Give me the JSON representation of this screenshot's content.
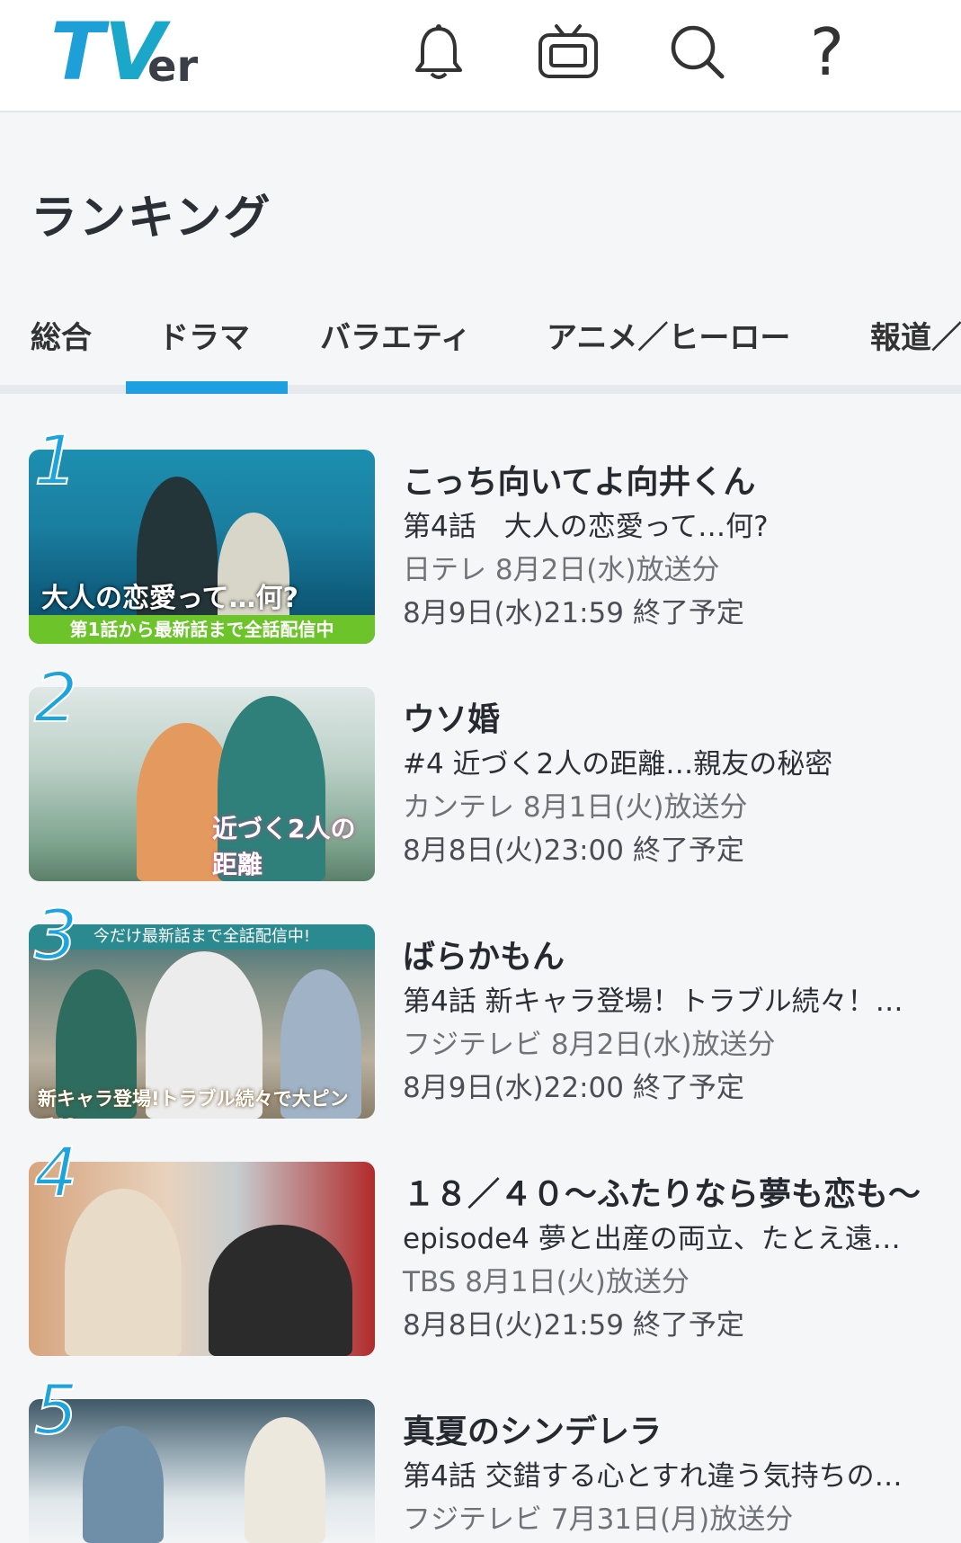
{
  "header": {
    "logo_text": {
      "t": "T",
      "v": "V",
      "er": "er"
    },
    "icons": [
      "bell-icon",
      "tv-icon",
      "search-icon",
      "help-icon"
    ],
    "help_glyph": "?"
  },
  "page_title": "ランキング",
  "tabs": [
    "総合",
    "ドラマ",
    "バラエティ",
    "アニメ／ヒーロー",
    "報道／"
  ],
  "accent_color": "#1ea0e0",
  "items": [
    {
      "rank": "1",
      "title": "こっち向いてよ向井くん",
      "episode": "第4話　大人の恋愛って…何?",
      "broadcast": "日テレ  8月2日(水)放送分",
      "end": "8月9日(水)21:59  終了予定",
      "thumb_caption": "大人の恋愛って…何?",
      "thumb_band": "第1話から最新話まで全話配信中"
    },
    {
      "rank": "2",
      "title": "ウソ婚",
      "episode": "#4  近づく2人の距離…親友の秘密",
      "broadcast": "カンテレ  8月1日(火)放送分",
      "end": "8月8日(火)23:00  終了予定",
      "thumb_caption": "近づく2人の距離"
    },
    {
      "rank": "3",
      "title": "ばらかもん",
      "episode": "第4話  新キャラ登場！トラブル続々！…",
      "broadcast": "フジテレビ  8月2日(水)放送分",
      "end": "8月9日(水)22:00  終了予定",
      "thumb_top": "今だけ最新話まで全話配信中!",
      "thumb_caption": "新キャラ登場!トラブル続々で大ピンチ!?"
    },
    {
      "rank": "4",
      "title": "１８／４０～ふたりなら夢も恋も～",
      "episode": "episode4  夢と出産の両立、たとえ遠…",
      "broadcast": "TBS  8月1日(火)放送分",
      "end": "8月8日(火)21:59  終了予定"
    },
    {
      "rank": "5",
      "title": "真夏のシンデレラ",
      "episode": "第4話  交錯する心とすれ違う気持ちの…",
      "broadcast": "フジテレビ  7月31日(月)放送分",
      "end": ""
    }
  ]
}
